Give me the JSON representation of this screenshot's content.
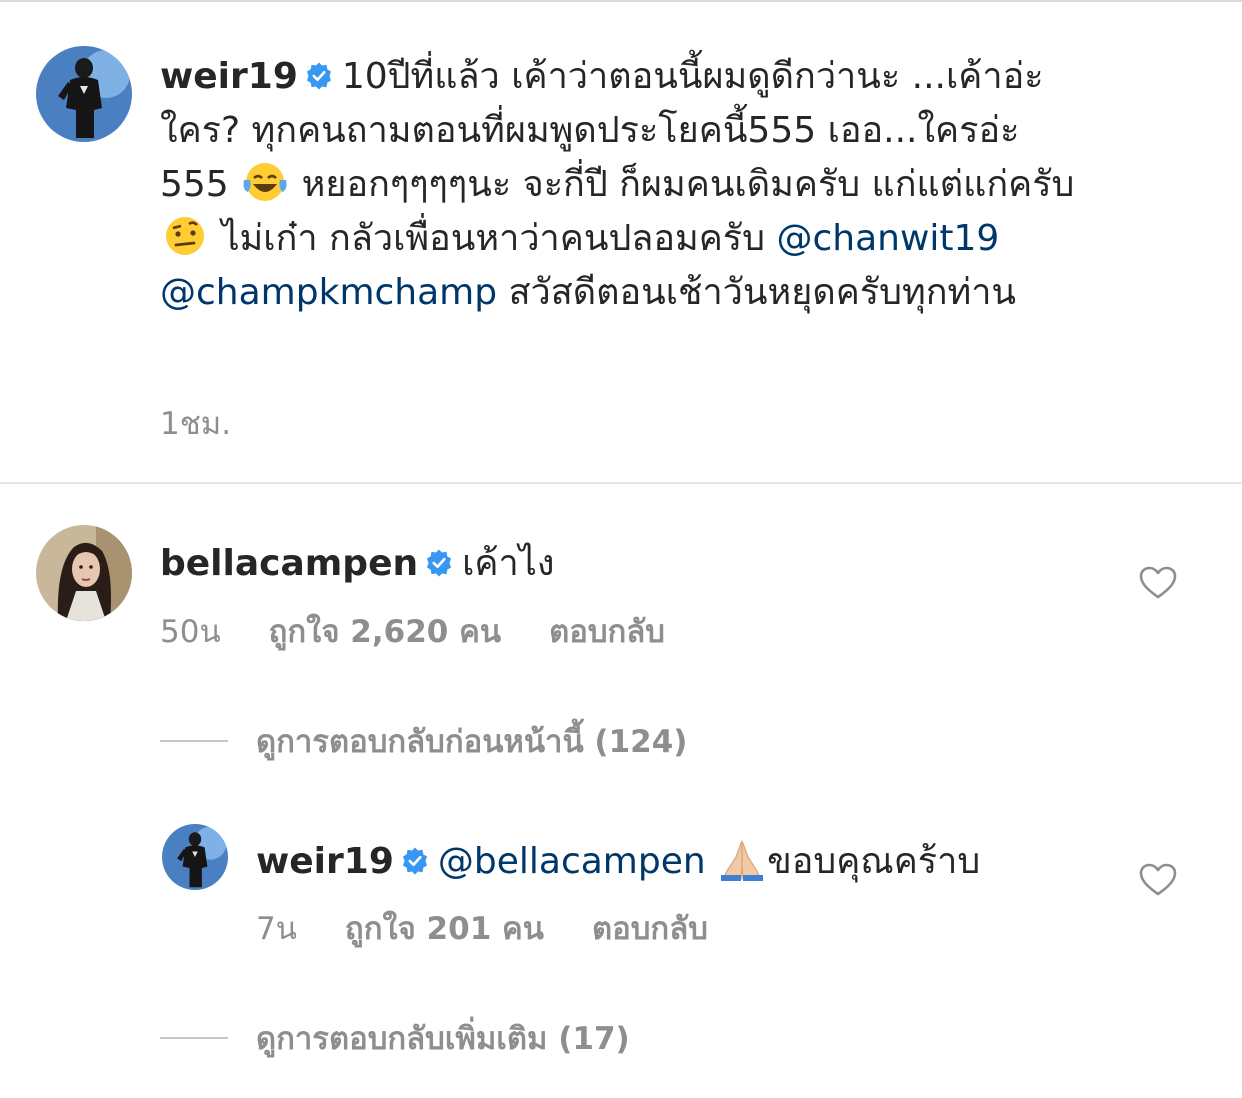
{
  "caption": {
    "username": "weir19",
    "text_parts": [
      "10ปีที่แล้ว เค้าว่าตอนนี้ผมดูดีกว่านะ ...เค้าอ่ะใคร? ทุกคนถามตอนที่ผมพูดประโยคนี้555 เออ...ใครอ่ะ 555",
      "หยอกๆๆๆๆนะ จะกี่ปี ก็ผมคนเดิมครับ แก่แต่แก่ครับ",
      "ไม่เก๋า กลัวเพื่อนหาว่าคนปลอมครับ",
      "สวัสดีตอนเช้าวันหยุดครับทุกท่าน"
    ],
    "mentions": [
      "@chanwit19",
      "@champkmchamp"
    ],
    "time": "1ชม.",
    "emojis": [
      "tears-of-joy-emoji",
      "raised-eyebrow-emoji"
    ]
  },
  "comment": {
    "username": "bellacampen",
    "text": "เค้าไง",
    "time": "50น",
    "likes": "ถูกใจ 2,620 คน",
    "reply_label": "ตอบกลับ",
    "view_previous": "ดูการตอบกลับก่อนหน้านี้ (124)"
  },
  "reply": {
    "username": "weir19",
    "mention": "@bellacampen",
    "text": "ขอบคุณคร้าบ",
    "emoji": "folded-hands-emoji",
    "time": "7น",
    "likes": "ถูกใจ 201 คน",
    "reply_label": "ตอบกลับ",
    "view_more": "ดูการตอบกลับเพิ่มเติม (17)"
  },
  "colors": {
    "text": "#262626",
    "secondary": "#8e8e8e",
    "mention": "#00376b",
    "verified": "#3897f0"
  }
}
